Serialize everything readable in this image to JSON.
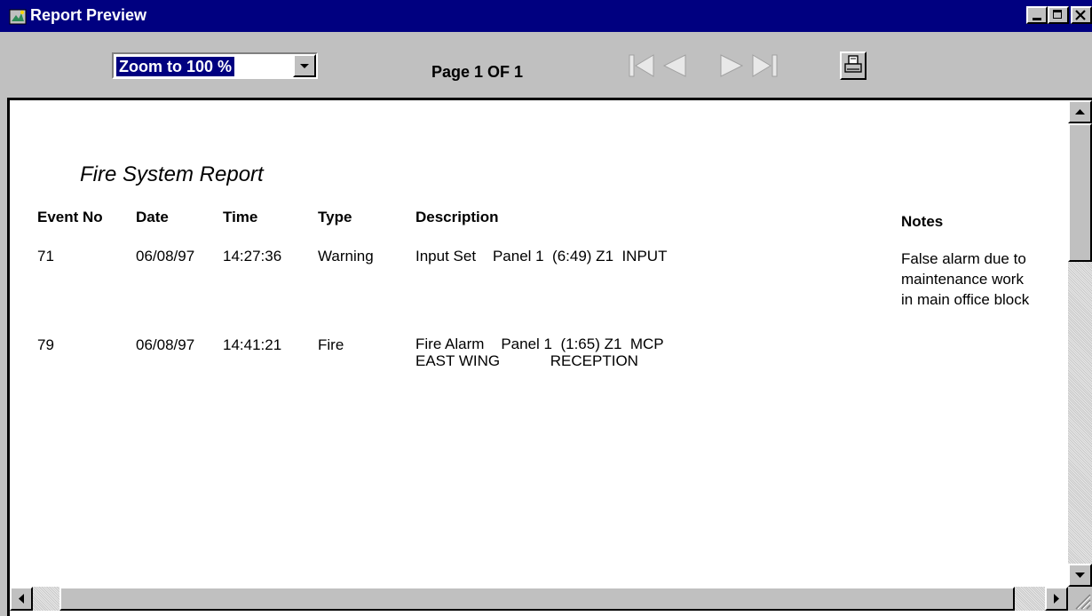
{
  "window": {
    "title": "Report Preview",
    "app_icon": "report-app-icon",
    "controls": [
      "minimize-icon",
      "maximize-icon",
      "close-icon"
    ]
  },
  "toolbar": {
    "zoom_value": "Zoom to 100 %",
    "page_indicator": "Page 1 OF 1",
    "nav_icons": [
      "first-page-icon",
      "previous-page-icon",
      "next-page-icon",
      "last-page-icon"
    ],
    "print_icon": "printer-icon"
  },
  "report": {
    "title": "Fire System Report",
    "columns": {
      "event_no": "Event No",
      "date": "Date",
      "time": "Time",
      "type": "Type",
      "description": "Description",
      "notes": "Notes"
    },
    "rows": [
      {
        "event_no": "71",
        "date": "06/08/97",
        "time": "14:27:36",
        "type": "Warning",
        "description": "Input Set    Panel 1  (6:49) Z1  INPUT",
        "notes_lines": [
          "False alarm due to",
          "maintenance work",
          "in main office block"
        ]
      },
      {
        "event_no": "79",
        "date": "06/08/97",
        "time": "14:41:21",
        "type": "Fire",
        "description_lines": [
          "Fire Alarm    Panel 1  (1:65) Z1  MCP",
          "EAST WING            RECEPTION"
        ],
        "notes_lines": []
      }
    ]
  },
  "colors": {
    "titlebar": "#000080",
    "face": "#c0c0c0",
    "selection": "#000080"
  }
}
